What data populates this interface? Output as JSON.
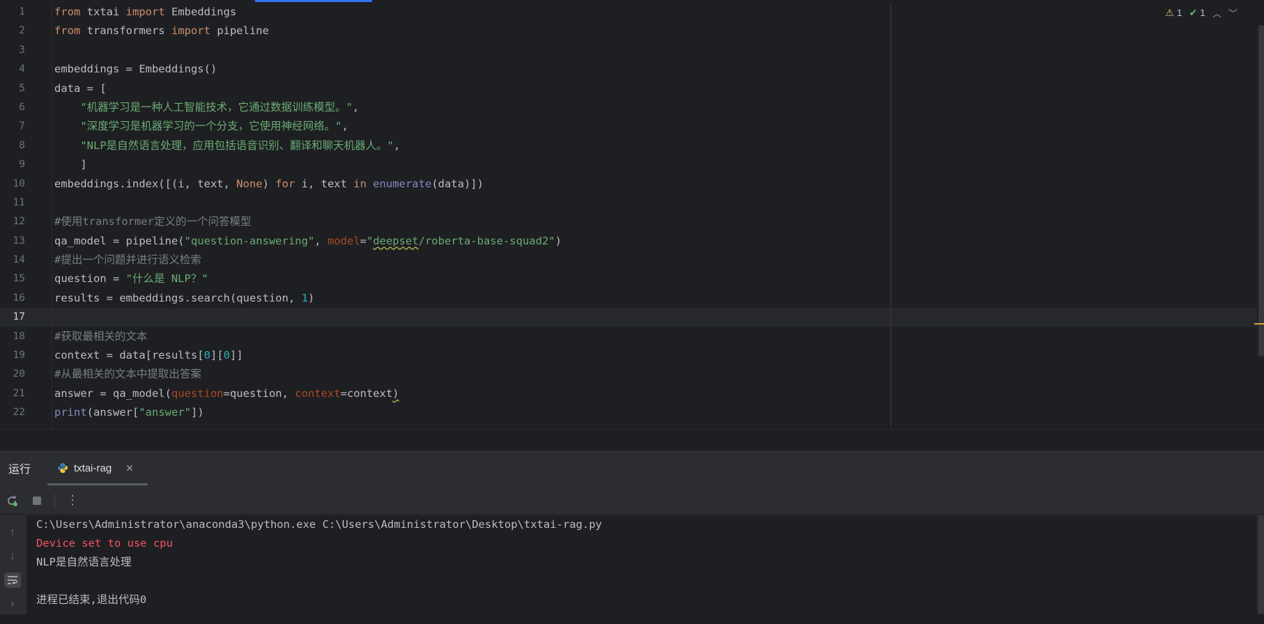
{
  "inspections": {
    "warnings": "1",
    "weak_warnings": "1"
  },
  "editor": {
    "current_line": 17,
    "lines": [
      [
        {
          "t": "from",
          "c": "kw"
        },
        {
          "t": " txtai ",
          "c": "plain"
        },
        {
          "t": "import",
          "c": "kw"
        },
        {
          "t": " Embeddings",
          "c": "plain"
        }
      ],
      [
        {
          "t": "from",
          "c": "kw"
        },
        {
          "t": " transformers ",
          "c": "plain"
        },
        {
          "t": "import",
          "c": "kw"
        },
        {
          "t": " pipeline",
          "c": "plain"
        }
      ],
      [],
      [
        {
          "t": "embeddings = Embeddings()",
          "c": "plain"
        }
      ],
      [
        {
          "t": "data = [",
          "c": "plain"
        }
      ],
      [
        {
          "t": "    ",
          "c": "plain"
        },
        {
          "t": "\"机器学习是一种人工智能技术，它通过数据训练模型。\"",
          "c": "str"
        },
        {
          "t": ",",
          "c": "plain"
        }
      ],
      [
        {
          "t": "    ",
          "c": "plain"
        },
        {
          "t": "\"深度学习是机器学习的一个分支，它使用神经网络。\"",
          "c": "str"
        },
        {
          "t": ",",
          "c": "plain"
        }
      ],
      [
        {
          "t": "    ",
          "c": "plain"
        },
        {
          "t": "\"NLP是自然语言处理，应用包括语音识别、翻译和聊天机器人。\"",
          "c": "str"
        },
        {
          "t": ",",
          "c": "plain"
        }
      ],
      [
        {
          "t": "    ]",
          "c": "plain"
        }
      ],
      [
        {
          "t": "embeddings.index([(i, text, ",
          "c": "plain"
        },
        {
          "t": "None",
          "c": "kw"
        },
        {
          "t": ") ",
          "c": "plain"
        },
        {
          "t": "for",
          "c": "kw"
        },
        {
          "t": " i, text ",
          "c": "plain"
        },
        {
          "t": "in",
          "c": "kw"
        },
        {
          "t": " ",
          "c": "plain"
        },
        {
          "t": "enumerate",
          "c": "bi"
        },
        {
          "t": "(data)])",
          "c": "plain"
        }
      ],
      [],
      [
        {
          "t": "#使用transformer定义的一个问答模型",
          "c": "cmt"
        }
      ],
      [
        {
          "t": "qa_model = pipeline(",
          "c": "plain"
        },
        {
          "t": "\"question-answering\"",
          "c": "str"
        },
        {
          "t": ", ",
          "c": "plain"
        },
        {
          "t": "model",
          "c": "param"
        },
        {
          "t": "=",
          "c": "plain"
        },
        {
          "t": "\"",
          "c": "str"
        },
        {
          "t": "deepset",
          "c": "str squig"
        },
        {
          "t": "/roberta-base-squad2\"",
          "c": "str"
        },
        {
          "t": ")",
          "c": "plain"
        }
      ],
      [
        {
          "t": "#提出一个问题并进行语义检索",
          "c": "cmt"
        }
      ],
      [
        {
          "t": "question = ",
          "c": "plain"
        },
        {
          "t": "\"什么是 NLP？\"",
          "c": "str"
        }
      ],
      [
        {
          "t": "results = embeddings.search(question, ",
          "c": "plain"
        },
        {
          "t": "1",
          "c": "num"
        },
        {
          "t": ")",
          "c": "plain"
        }
      ],
      [],
      [
        {
          "t": "#获取最相关的文本",
          "c": "cmt"
        }
      ],
      [
        {
          "t": "context = data[results[",
          "c": "plain"
        },
        {
          "t": "0",
          "c": "num"
        },
        {
          "t": "][",
          "c": "plain"
        },
        {
          "t": "0",
          "c": "num"
        },
        {
          "t": "]]",
          "c": "plain"
        }
      ],
      [
        {
          "t": "#从最相关的文本中提取出答案",
          "c": "cmt"
        }
      ],
      [
        {
          "t": "answer = qa_model(",
          "c": "plain"
        },
        {
          "t": "question",
          "c": "param"
        },
        {
          "t": "=question, ",
          "c": "plain"
        },
        {
          "t": "context",
          "c": "param"
        },
        {
          "t": "=context",
          "c": "plain"
        },
        {
          "t": ")",
          "c": "plain squig"
        }
      ],
      [
        {
          "t": "print",
          "c": "bi"
        },
        {
          "t": "(answer[",
          "c": "plain"
        },
        {
          "t": "\"answer\"",
          "c": "str"
        },
        {
          "t": "])",
          "c": "plain"
        }
      ]
    ]
  },
  "run_panel": {
    "title": "运行",
    "tab_label": "txtai-rag",
    "console_lines": [
      {
        "text": "C:\\Users\\Administrator\\anaconda3\\python.exe C:\\Users\\Administrator\\Desktop\\txtai-rag.py",
        "kind": "normal"
      },
      {
        "text": "Device set to use cpu",
        "kind": "err"
      },
      {
        "text": "NLP是自然语言处理",
        "kind": "normal"
      },
      {
        "text": "",
        "kind": "normal"
      },
      {
        "text": "进程已结束,退出代码0",
        "kind": "normal"
      }
    ]
  },
  "icons": {
    "warning": "warning-triangle-icon",
    "weak_warning": "check-icon",
    "rerun": "rerun-icon",
    "stop": "stop-icon",
    "more": "more-vertical-icon",
    "python": "python-icon"
  },
  "colors": {
    "keyword": "#cf8e6d",
    "string": "#6aab73",
    "comment": "#7a7e85",
    "number": "#2aacb8",
    "builtin": "#8888c6",
    "param": "#aa4926",
    "error_output": "#f75464",
    "accent": "#3574f0"
  }
}
